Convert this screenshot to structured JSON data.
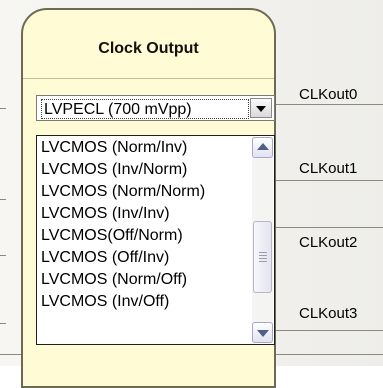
{
  "card": {
    "title": "Clock Output"
  },
  "select": {
    "value": "LVPECL (700 mVpp)"
  },
  "dropdown": {
    "options": [
      "LVCMOS (Norm/Inv)",
      "LVCMOS (Inv/Norm)",
      "LVCMOS (Norm/Norm)",
      "LVCMOS (Inv/Inv)",
      "LVCMOS(Off/Norm)",
      "LVCMOS (Off/Inv)",
      "LVCMOS (Norm/Off)",
      "LVCMOS (Inv/Off)"
    ]
  },
  "outputs": {
    "labels": [
      "CLKout0",
      "CLKout1",
      "CLKout2",
      "CLKout3"
    ]
  },
  "icons": {
    "select_arrow": "chevron-down-icon",
    "scroll_up": "scroll-up-arrow-icon",
    "scroll_down": "scroll-down-arrow-icon"
  },
  "colors": {
    "card_background": "#fffbd4",
    "panel_background": "#f2f1ee",
    "scroll_arrow": "#4d6185"
  }
}
